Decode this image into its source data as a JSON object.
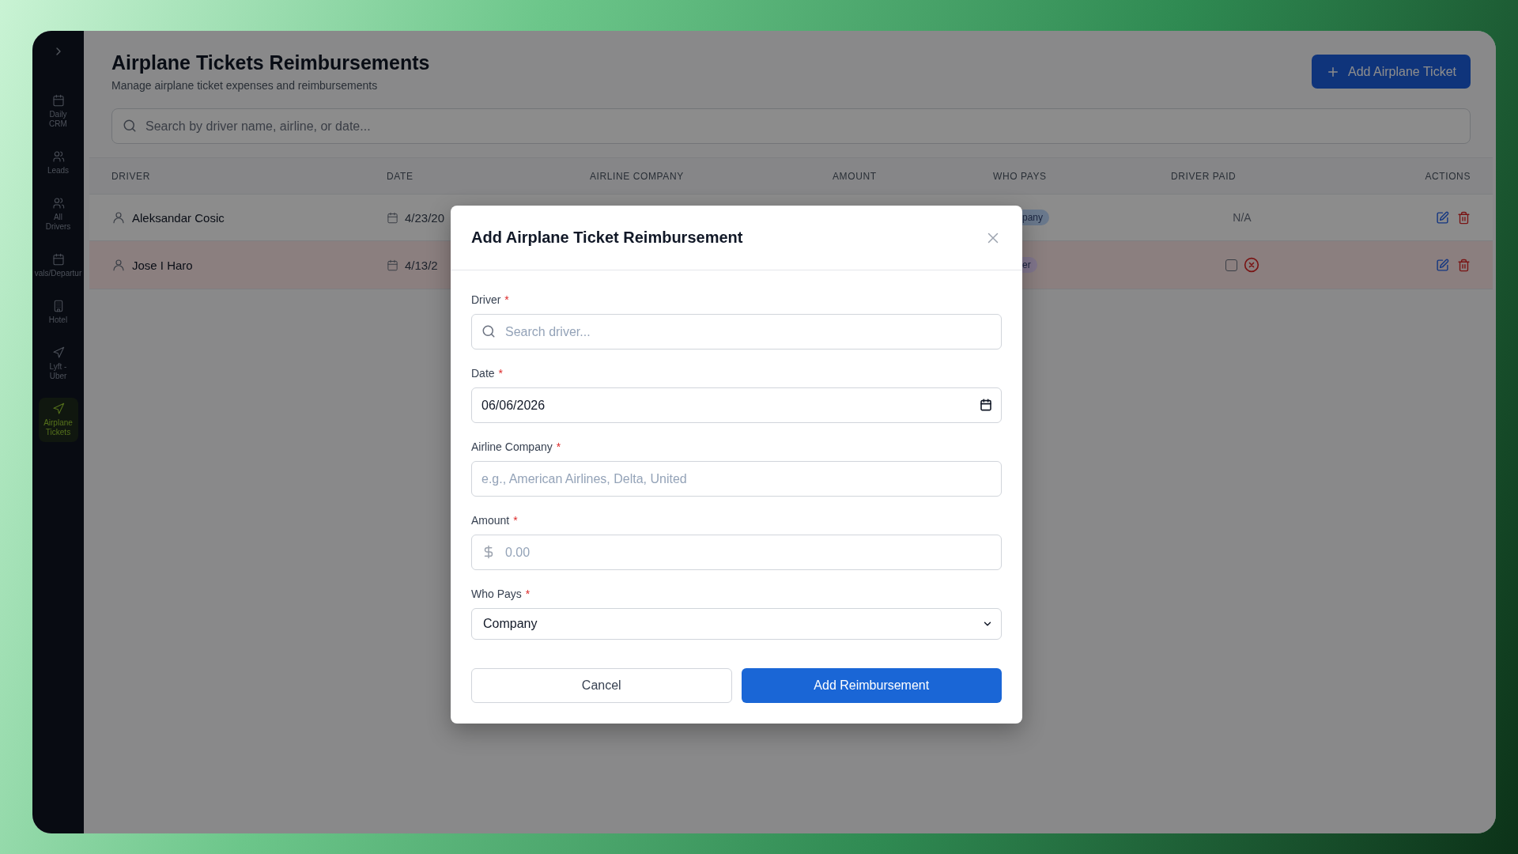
{
  "sidebar": {
    "items": [
      {
        "label": "Daily CRM",
        "selected": false
      },
      {
        "label": "Leads",
        "selected": false
      },
      {
        "label": "All Drivers",
        "selected": false
      },
      {
        "label": "vals/Departur",
        "selected": false
      },
      {
        "label": "Hotel",
        "selected": false
      },
      {
        "label": "Lyft - Uber",
        "selected": false
      },
      {
        "label": "Airplane Tickets",
        "selected": true
      }
    ]
  },
  "header": {
    "title": "Airplane Tickets Reimbursements",
    "subtitle": "Manage airplane ticket expenses and reimbursements",
    "add_button": "Add Airplane Ticket"
  },
  "search": {
    "placeholder": "Search by driver name, airline, or date..."
  },
  "table": {
    "columns": [
      "DRIVER",
      "DATE",
      "AIRLINE COMPANY",
      "AMOUNT",
      "WHO PAYS",
      "DRIVER PAID",
      "ACTIONS"
    ],
    "rows": [
      {
        "driver": "Aleksandar Cosic",
        "date": "4/23/20",
        "who_pays": {
          "text": "pany",
          "color": "#69788c"
        },
        "driver_paid": {
          "kind": "text",
          "text": "N/A"
        },
        "highlighted": false
      },
      {
        "driver": "Jose I Haro",
        "date": "4/13/2",
        "who_pays": {
          "text": "er",
          "color": "#80758c"
        },
        "driver_paid": {
          "kind": "checkbox",
          "checked": false
        },
        "highlighted": true
      }
    ]
  },
  "modal": {
    "title": "Add Airplane Ticket Reimbursement",
    "fields": [
      {
        "kind": "search",
        "label": "Driver",
        "required_mark": "*",
        "placeholder": "Search driver..."
      },
      {
        "kind": "date",
        "label": "Date",
        "required_mark": "*",
        "value": "06/06/2026"
      },
      {
        "kind": "text",
        "label": "Airline Company",
        "required_mark": "*",
        "placeholder": "e.g., American Airlines, Delta, United"
      },
      {
        "kind": "currency",
        "label": "Amount",
        "required_mark": "*",
        "placeholder": "0.00"
      },
      {
        "kind": "select",
        "label": "Who Pays",
        "required_mark": "*",
        "value": "Company"
      }
    ],
    "cancel_button": "Cancel",
    "submit_button": "Add Reimbursement"
  }
}
